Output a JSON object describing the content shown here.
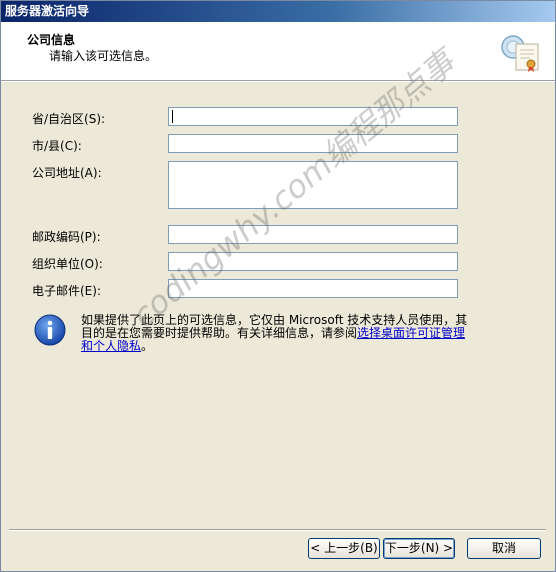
{
  "window": {
    "title": "服务器激活向导"
  },
  "header": {
    "title": "公司信息",
    "subtitle": "请输入该可选信息。"
  },
  "form": {
    "fields": [
      {
        "label": "省/自治区(S):",
        "value": ""
      },
      {
        "label": "市/县(C):",
        "value": ""
      },
      {
        "label": "公司地址(A):",
        "value": ""
      },
      {
        "label": "邮政编码(P):",
        "value": ""
      },
      {
        "label": "组织单位(O):",
        "value": ""
      },
      {
        "label": "电子邮件(E):",
        "value": ""
      }
    ]
  },
  "info": {
    "text": "如果提供了此页上的可选信息，它仅由 Microsoft 技术支持人员使用，其目的是在您需要时提供帮助。有关详细信息，请参阅",
    "link": "选择桌面许可证管理和个人隐私",
    "suffix": "。",
    "icon": "info-icon"
  },
  "buttons": {
    "back": "< 上一步(B)",
    "next": "下一步(N) >",
    "cancel": "取消"
  },
  "watermark": "codingwhy.com编程那点事"
}
